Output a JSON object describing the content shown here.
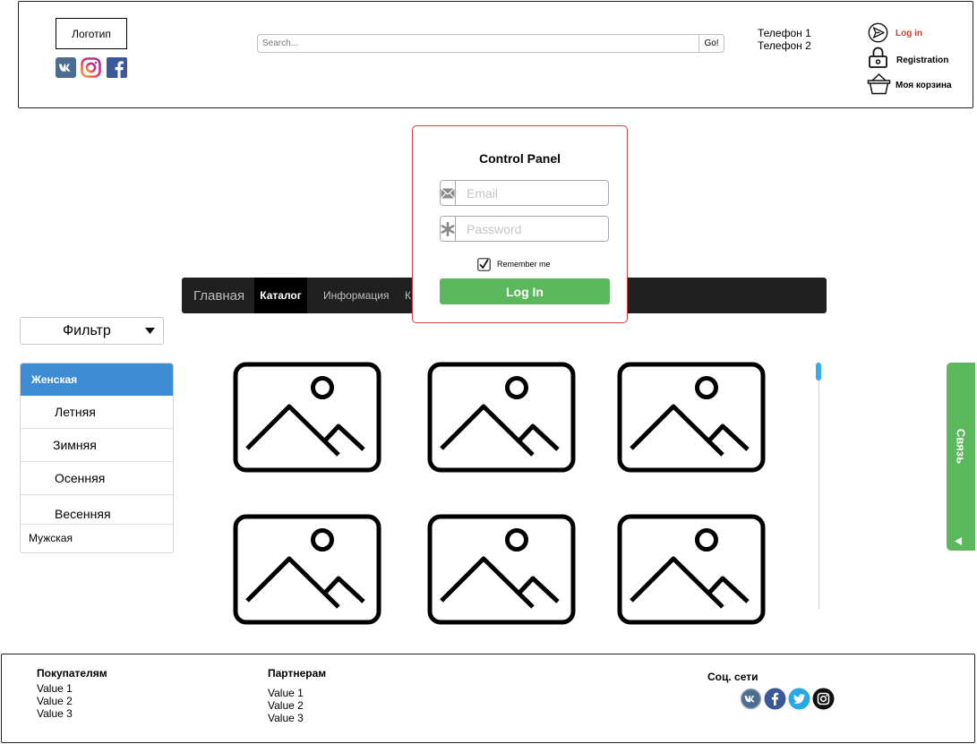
{
  "header": {
    "logo_text": "Логотип",
    "social_icons": [
      "vk-icon",
      "instagram-icon",
      "facebook-icon"
    ],
    "search": {
      "placeholder": "Search...",
      "button_label": "Go!"
    },
    "phones": [
      "Телефон 1",
      "Телефон 2"
    ],
    "links": {
      "login": "Log in",
      "registration": "Registration",
      "cart": "Моя корзина"
    },
    "login_color": "#e0342c"
  },
  "nav": {
    "items": [
      "Главная",
      "Каталог",
      "Информация",
      "К"
    ],
    "active_index": 1
  },
  "filter": {
    "label": "Фильтр"
  },
  "sidebar": {
    "category": "Женская",
    "items": [
      "Летняя",
      "Зимняя",
      "Осенняя",
      "Весенняя"
    ],
    "category2": "Мужская",
    "accent_color": "#3d8bd3"
  },
  "gallery": {
    "image_icon": "image-placeholder-icon",
    "count": 6
  },
  "contact_tab": {
    "label": "Связь",
    "color": "#5cb85c"
  },
  "modal": {
    "title": "Control Panel",
    "email_placeholder": "Email",
    "password_placeholder": "Password",
    "remember_label": "Remember me",
    "remember_checked": true,
    "login_button": "Log In",
    "button_color": "#5cb85c",
    "border_color": "#d43f3f"
  },
  "footer": {
    "buyers": {
      "title": "Покупателям",
      "values": [
        "Value 1",
        "Value 2",
        "Value 3"
      ]
    },
    "partners": {
      "title": "Партнерам",
      "values": [
        "Value 1",
        "Value 2",
        "Value 3"
      ]
    },
    "social": {
      "title": "Соц. сети",
      "icons": [
        "vk-icon",
        "facebook-icon",
        "twitter-icon",
        "instagram-icon"
      ]
    }
  }
}
